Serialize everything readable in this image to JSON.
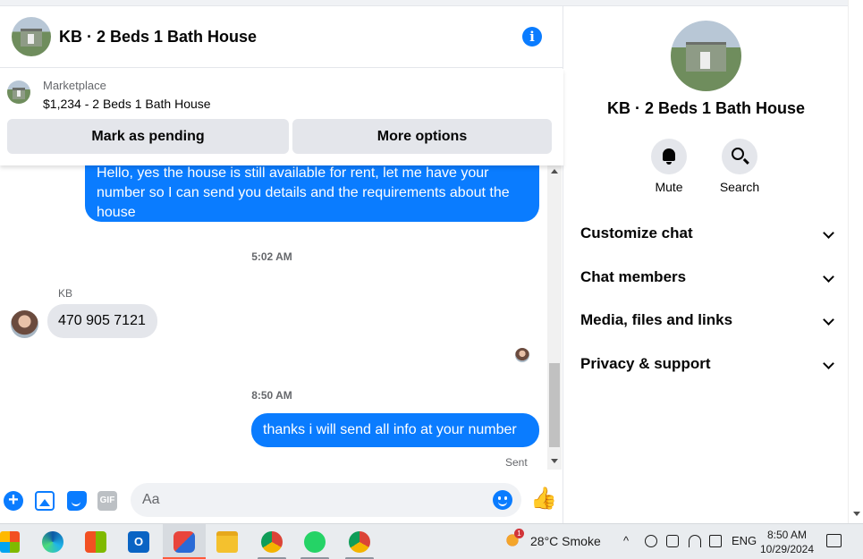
{
  "header": {
    "title": "KB · 2 Beds 1 Bath House"
  },
  "marketplace": {
    "label": "Marketplace",
    "listing": "$1,234 - 2 Beds 1 Bath House",
    "mark_pending_label": "Mark as pending",
    "more_options_label": "More options"
  },
  "messages": {
    "out1": "Hello, yes the house is still available for rent, let me have your number so I can send you details and the requirements about the house",
    "time1": "5:02 AM",
    "sender": "KB",
    "in1": "470 905 7121",
    "time2": "8:50 AM",
    "out2": "thanks i will send all info at your number",
    "status": "Sent"
  },
  "composer": {
    "placeholder": "Aa",
    "gif_label": "GIF"
  },
  "panel": {
    "title": "KB · 2 Beds 1 Bath House",
    "mute_label": "Mute",
    "search_label": "Search",
    "menu": [
      {
        "label": "Customize chat"
      },
      {
        "label": "Chat members"
      },
      {
        "label": "Media, files and links"
      },
      {
        "label": "Privacy & support"
      }
    ]
  },
  "taskbar": {
    "outlook_letter": "O",
    "weather_badge": "1",
    "weather": "28°C  Smoke",
    "tray_chevron": "^",
    "language": "ENG",
    "time": "8:50 AM",
    "date": "10/29/2024"
  },
  "colors": {
    "accent": "#0a7cff",
    "bubble_in": "#e4e6eb"
  }
}
